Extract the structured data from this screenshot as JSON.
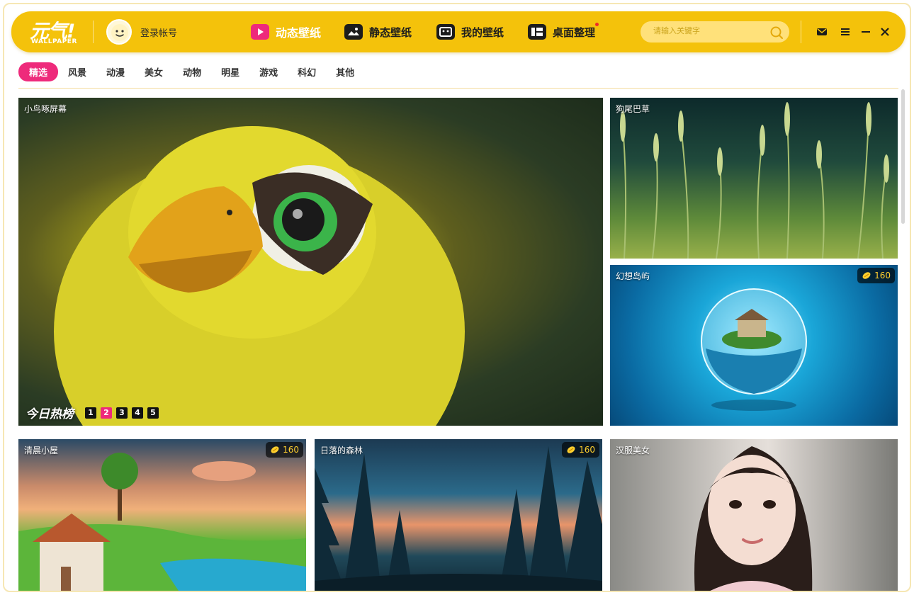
{
  "app": {
    "logo_text": "元气!",
    "logo_sub": "WALLPAPER",
    "login_label": "登录帐号"
  },
  "nav": {
    "dynamic": "动态壁纸",
    "static": "静态壁纸",
    "mine": "我的壁纸",
    "desktop": "桌面整理"
  },
  "search": {
    "placeholder": "请输入关键字"
  },
  "categories": [
    "精选",
    "风景",
    "动漫",
    "美女",
    "动物",
    "明星",
    "游戏",
    "科幻",
    "其他"
  ],
  "tiles": {
    "featured": {
      "title": "小鸟啄屏幕"
    },
    "grass": {
      "title": "狗尾巴草"
    },
    "island": {
      "title": "幻想岛屿",
      "coins": "160"
    },
    "cabin": {
      "title": "清晨小屋",
      "coins": "160"
    },
    "forest": {
      "title": "日落的森林",
      "coins": "160"
    },
    "hanfu": {
      "title": "汉服美女"
    }
  },
  "hot": {
    "title": "今日热榜",
    "pages": [
      "1",
      "2",
      "3",
      "4",
      "5"
    ],
    "active_page": "2"
  },
  "colors": {
    "brand_yellow": "#f4c20b",
    "accent_pink": "#ee2a7b"
  }
}
